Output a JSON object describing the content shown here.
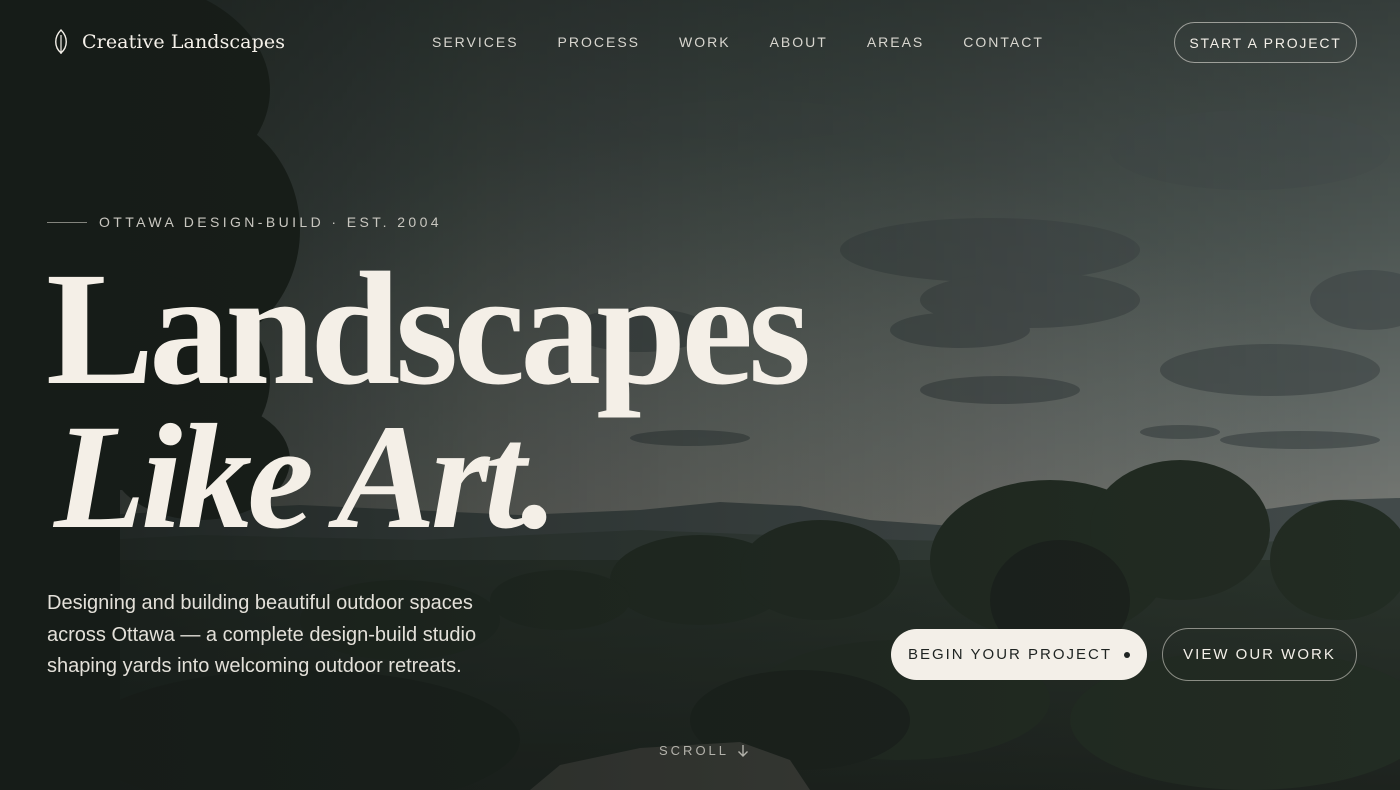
{
  "brand": {
    "name": "Creative Landscapes",
    "logo_icon": "leaf-icon"
  },
  "nav": {
    "items": [
      {
        "label": "SERVICES"
      },
      {
        "label": "PROCESS"
      },
      {
        "label": "WORK"
      },
      {
        "label": "ABOUT"
      },
      {
        "label": "AREAS"
      },
      {
        "label": "CONTACT"
      }
    ],
    "cta_label": "START A PROJECT"
  },
  "hero": {
    "eyebrow": "OTTAWA DESIGN-BUILD · EST. 2004",
    "headline_line1": "Landscapes",
    "headline_line2": "Like Art.",
    "subcopy": "Designing and building beautiful outdoor spaces across Ottawa — a complete design-build studio shaping yards into welcoming outdoor retreats.",
    "primary_button": "BEGIN YOUR PROJECT",
    "secondary_button": "VIEW OUR WORK",
    "scroll_label": "SCROLL",
    "scroll_icon": "arrow-down-icon"
  },
  "colors": {
    "cream": "#f3efe8",
    "dark_text": "#1f2422",
    "sky_top": "#3c4744",
    "sky_horizon": "#8a8c86"
  }
}
